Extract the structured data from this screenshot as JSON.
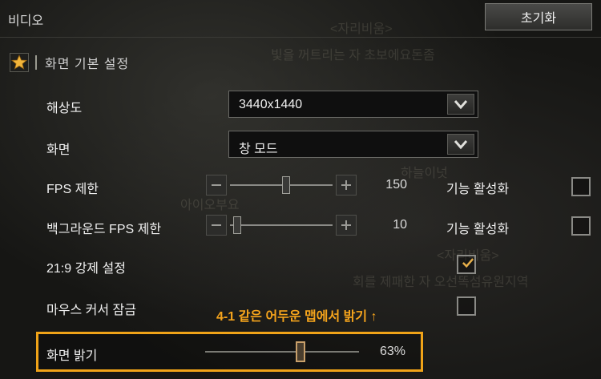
{
  "header": {
    "title": "비디오",
    "reset_label": "초기화"
  },
  "section": {
    "title": "화면 기본 설정",
    "icon": "star-icon"
  },
  "settings": {
    "resolution": {
      "label": "해상도",
      "value": "3440x1440"
    },
    "screen": {
      "label": "화면",
      "value": "창 모드"
    },
    "fps_limit": {
      "label": "FPS 제한",
      "value": "150",
      "level": 0.55,
      "enable_label": "기능 활성화",
      "enabled": false
    },
    "bg_fps_limit": {
      "label": "백그라운드 FPS 제한",
      "value": "10",
      "level": 0.03,
      "enable_label": "기능 활성화",
      "enabled": false
    },
    "force_219": {
      "label": "21:9 강제 설정",
      "checked": true
    },
    "mouse_lock": {
      "label": "마우스 커서 잠금",
      "checked": false
    },
    "brightness": {
      "label": "화면 밝기",
      "value": "63%",
      "level": 0.63
    }
  },
  "annotation": {
    "text": "4-1 같은 어두운 맵에서 밝기 ↑",
    "color": "#f5a41c"
  },
  "background_text": [
    "<자리비움>",
    "빛을 꺼트리는 자 초보에요돈좀",
    "<자리비움>",
    "회를 제패한 자 오선똑섬유원지역",
    "하늘이넛",
    "아이오부요"
  ],
  "colors": {
    "accent": "#f0a318",
    "checkbox_mark": "#e8b04a"
  }
}
